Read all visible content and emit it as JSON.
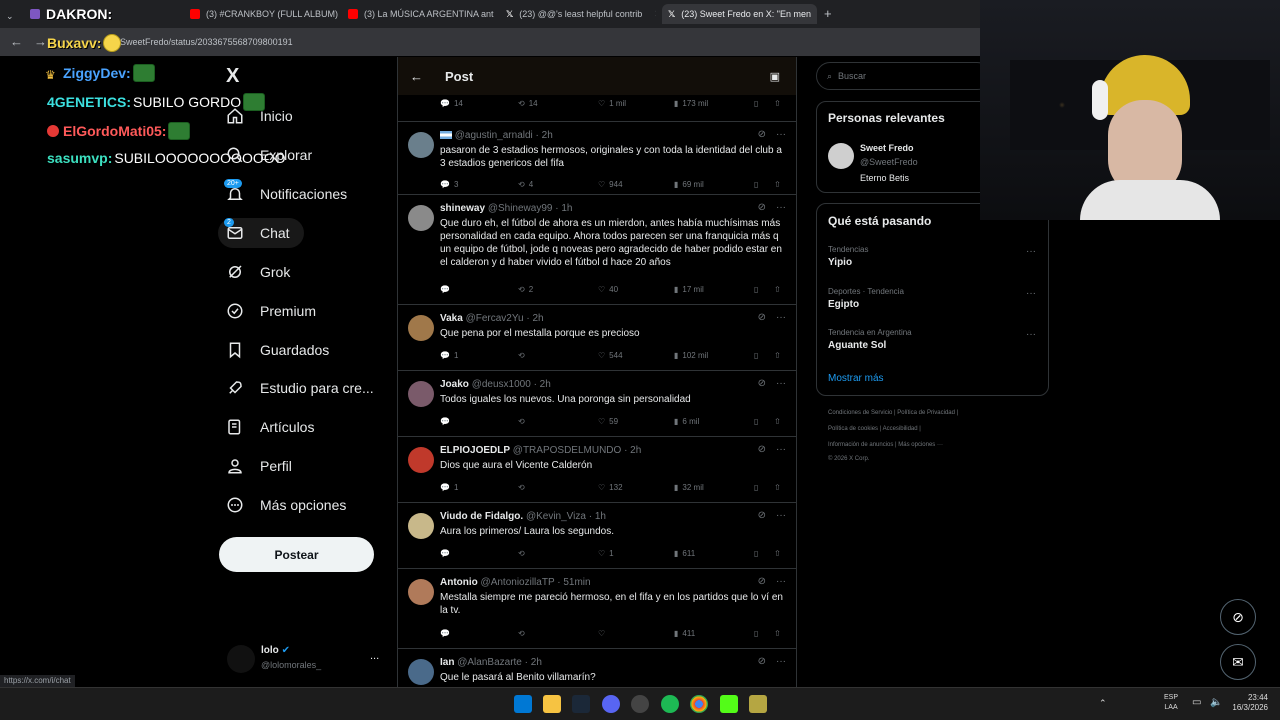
{
  "browser": {
    "tabs": [
      {
        "label": "DAKRON:",
        "color": "#f4b400"
      },
      {
        "label": "(3) #CRANKBOY (FULL ALBUM)",
        "color": "#ff0000"
      },
      {
        "label": "(3) La MÚSICA ARGENTINA ant",
        "color": "#ff0000"
      },
      {
        "label": "(23) @@'s least helpful contrib",
        "color": "#ffffff"
      },
      {
        "label": "(23) Sweet Fredo en X: \"En men",
        "color": "#ffffff"
      }
    ],
    "new_tab": "+",
    "url": "m/SweetFredo/status/2033675568709800191"
  },
  "stream_chat": [
    {
      "user": "Buxavv:",
      "message": "",
      "user_color": "#f6d54a"
    },
    {
      "user": "ZiggyDev:",
      "message": "",
      "user_color": "#4aa3ff"
    },
    {
      "user": "4GENETICS:",
      "message": "SUBILO GORDO",
      "user_color": "#3ce0e0"
    },
    {
      "user": "ElGordoMati05:",
      "message": "",
      "user_color": "#ff5a5a"
    },
    {
      "user": "sasumvp:",
      "message": "SUBILOOOOOOOOOOOO",
      "user_color": "#3ce0c0"
    }
  ],
  "sidebar": {
    "logo": "X",
    "items": [
      {
        "label": "Inicio",
        "icon": "home-icon"
      },
      {
        "label": "Explorar",
        "icon": "search-icon"
      },
      {
        "label": "Notificaciones",
        "icon": "bell-icon",
        "badge": "20+"
      },
      {
        "label": "Chat",
        "icon": "mail-icon",
        "badge": "2"
      },
      {
        "label": "Grok",
        "icon": "grok-icon"
      },
      {
        "label": "Premium",
        "icon": "verified-icon"
      },
      {
        "label": "Guardados",
        "icon": "bookmark-icon"
      },
      {
        "label": "Estudio para cre...",
        "icon": "rocket-icon"
      },
      {
        "label": "Artículos",
        "icon": "articles-icon"
      },
      {
        "label": "Perfil",
        "icon": "person-icon"
      },
      {
        "label": "Más opciones",
        "icon": "more-circle-icon"
      }
    ],
    "post_button": "Postear",
    "account": {
      "name": "lolo",
      "handle": "@lolomorales_",
      "more": "..."
    }
  },
  "main": {
    "title": "Post",
    "top_actions": {
      "replies": "14",
      "reposts": "14",
      "likes": "1 mil",
      "views": "173 mil"
    },
    "replies": [
      {
        "name": "",
        "handle": "@agustin_arnaldi",
        "time": "· 2h",
        "text": "pasaron de 3 estadios hermosos, originales y con toda la identidad del club a 3 estadios genericos del fifa",
        "replies": "3",
        "reposts": "4",
        "likes": "944",
        "views": "69 mil",
        "avatar_color": "#6a7f8c"
      },
      {
        "name": "shineway",
        "handle": "@Shineway99",
        "time": "· 1h",
        "text": "Que duro eh, el fútbol de ahora es un mierdon, antes había muchísimas más personalidad en cada equipo. Ahora todos parecen ser una franquicia más q un equipo de fútbol, jode q noveas pero agradecido de haber podido estar en el calderon y d haber vivido el fútbol d hace 20 años",
        "replies": "",
        "reposts": "2",
        "likes": "40",
        "views": "17 mil",
        "avatar_color": "#8a8a8a"
      },
      {
        "name": "Vaka",
        "handle": "@Fercav2Yu",
        "time": "· 2h",
        "text": "Que pena por el mestalla porque es precioso",
        "replies": "1",
        "reposts": "",
        "likes": "544",
        "views": "102 mil",
        "avatar_color": "#a0784a"
      },
      {
        "name": "Joako",
        "handle": "@deusx1000",
        "time": "· 2h",
        "text": "Todos iguales los nuevos. Una poronga sin personalidad",
        "replies": "",
        "reposts": "",
        "likes": "59",
        "views": "6 mil",
        "avatar_color": "#7a5a6a"
      },
      {
        "name": "ELPIOJOEDLP",
        "handle": "@TRAPOSDELMUNDO",
        "time": "· 2h",
        "text": "Dios que aura el Vicente Calderón",
        "replies": "1",
        "reposts": "",
        "likes": "132",
        "views": "32 mil",
        "avatar_color": "#c0392b"
      },
      {
        "name": "Viudo de Fidalgo.",
        "handle": "@Kevin_Viza",
        "time": "· 1h",
        "text": "Aura los primeros/ Laura los segundos.",
        "replies": "",
        "reposts": "",
        "likes": "1",
        "views": "611",
        "avatar_color": "#c8b88a"
      },
      {
        "name": "Antonio",
        "handle": "@AntoniozillaTP",
        "time": "· 51min",
        "text": "Mestalla siempre me pareció hermoso, en el fifa y en los partidos que lo ví en la tv.",
        "replies": "",
        "reposts": "",
        "likes": "",
        "views": "411",
        "avatar_color": "#b07a5a"
      },
      {
        "name": "Ian",
        "handle": "@AlanBazarte",
        "time": "· 2h",
        "text": "Que le pasará al Benito villamarín?",
        "replies": "",
        "reposts": "",
        "likes": "",
        "views": "",
        "avatar_color": "#4a6a8a"
      }
    ]
  },
  "right": {
    "search_placeholder": "Buscar",
    "relevant_title": "Personas relevantes",
    "relevant": {
      "name": "Sweet Fredo",
      "handle": "@SweetFredo",
      "bio": "Eterno Betis"
    },
    "trending_title": "Qué está pasando",
    "trends": [
      {
        "context": "Tendencias",
        "name": "Yipio"
      },
      {
        "context": "Deportes · Tendencia",
        "name": "Egipto"
      },
      {
        "context": "Tendencia en Argentina",
        "name": "Aguante Sol"
      }
    ],
    "show_more": "Mostrar más",
    "footer": [
      "Condiciones de Servicio |  Política de Privacidad  |",
      "Política de cookies  |  Accesibilidad  |",
      "Información de anuncios  |  Más opciones ···",
      "© 2026 X Corp."
    ]
  },
  "status_url": "https://x.com/i/chat",
  "taskbar": {
    "lang": "ESP",
    "lang2": "LAA",
    "time": "23:44",
    "date": "16/3/2026"
  }
}
